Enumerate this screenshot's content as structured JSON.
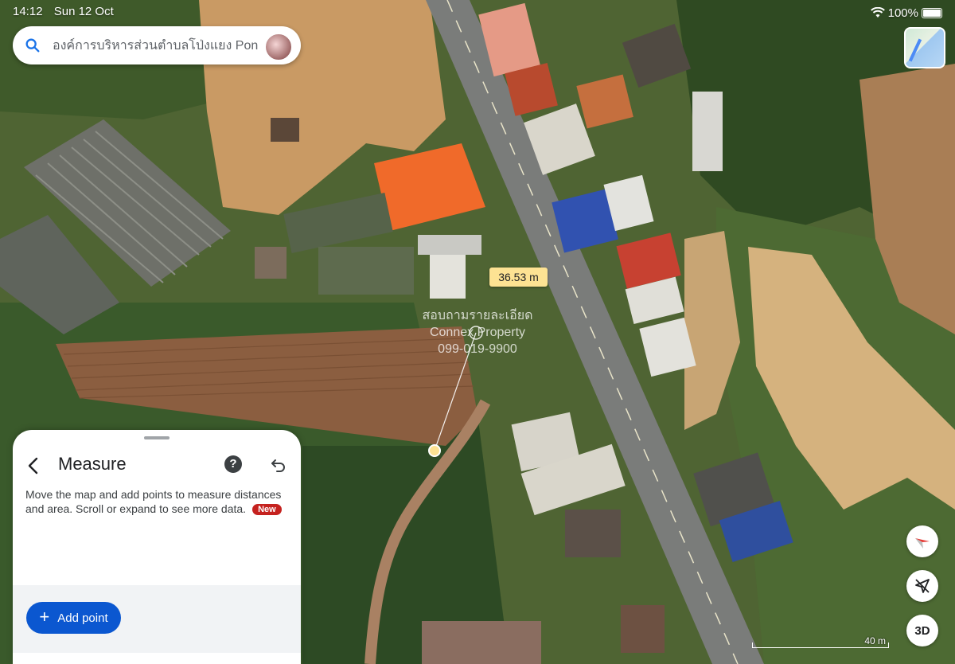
{
  "status_bar": {
    "time": "14:12",
    "date": "Sun 12 Oct",
    "battery": "100%"
  },
  "search": {
    "query": "องค์การบริหารส่วนตำบลโป่งแยง Pong Yaeng"
  },
  "measurement": {
    "distance_label": "36.53 m"
  },
  "watermark": {
    "line1": "สอบถามรายละเอียด",
    "line2": "Connex Property",
    "line3": "099-019-9900"
  },
  "measure_panel": {
    "title": "Measure",
    "description": "Move the map and add points to measure distances and area. Scroll or expand to see more data.",
    "new_badge": "New",
    "add_point_label": "Add point"
  },
  "map_controls": {
    "btn_3d": "3D",
    "scale_label": "40 m"
  },
  "icons": [
    "search-icon",
    "back-icon",
    "help-icon",
    "undo-icon",
    "compass-icon",
    "location-off-icon",
    "layers-icon",
    "wifi-icon",
    "battery-icon",
    "plus-icon"
  ],
  "colors": {
    "accent": "#0b57d0",
    "distance_label_bg": "#fde293",
    "badge_red": "#c5221f"
  }
}
